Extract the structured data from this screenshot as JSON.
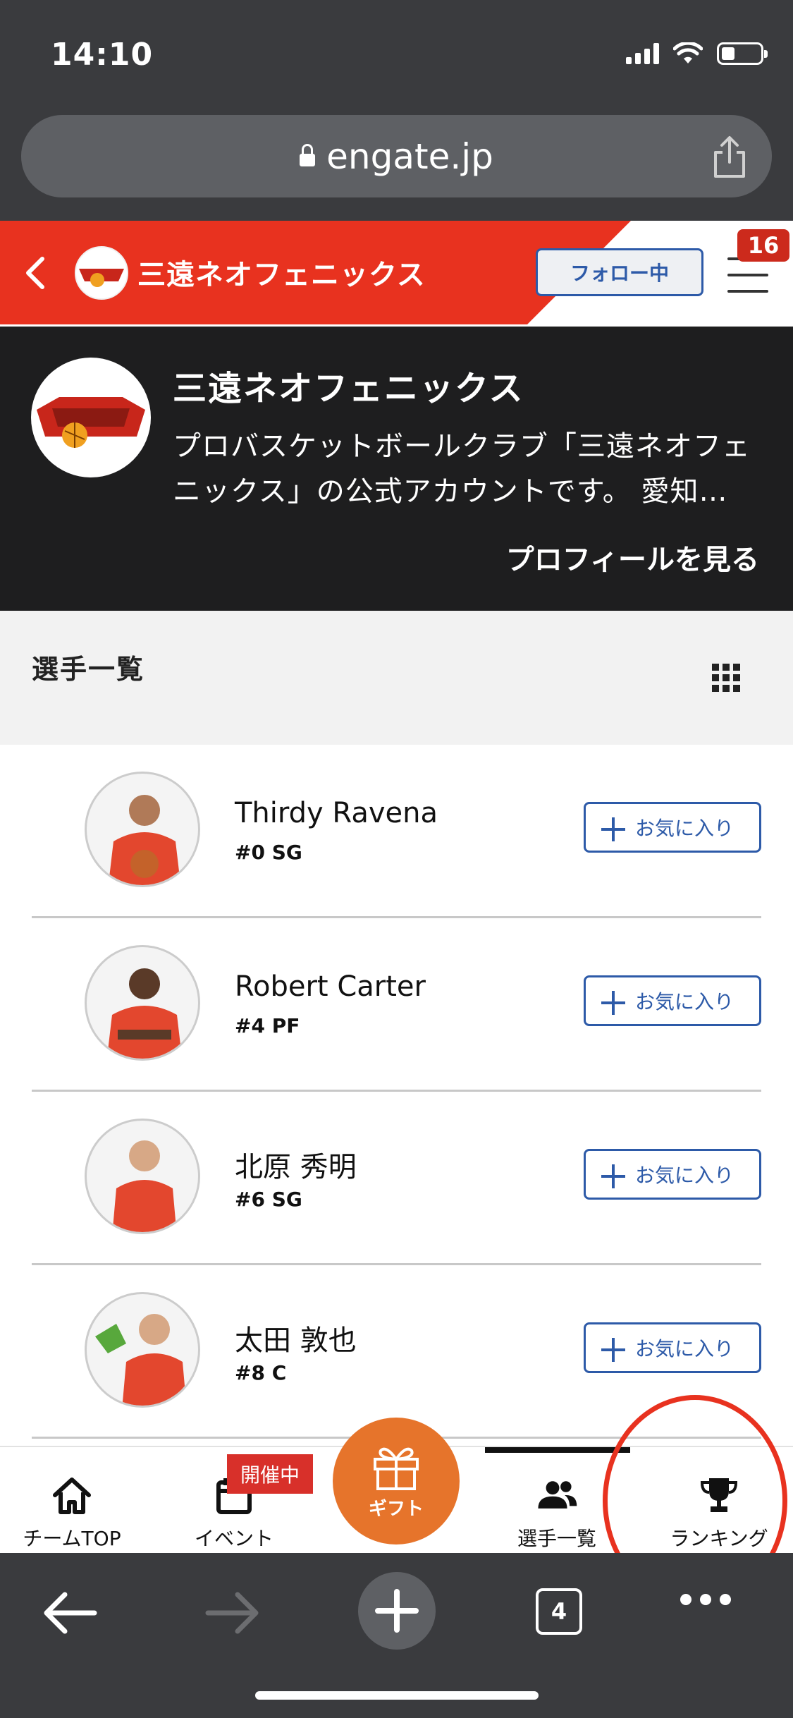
{
  "status_bar": {
    "time": "14:10"
  },
  "browser": {
    "url": "engate.jp",
    "tab_count": "4"
  },
  "team_header": {
    "team_name": "三遠ネオフェニックス",
    "follow_label": "フォロー中",
    "notification_count": "16"
  },
  "profile": {
    "name": "三遠ネオフェニックス",
    "description": "プロバスケットボールクラブ「三遠ネオフェニックス」の公式アカウントです。 愛知…",
    "profile_link": "プロフィールを見る"
  },
  "section": {
    "title": "選手一覧"
  },
  "players": [
    {
      "name": "Thirdy Ravena",
      "position": "#0 SG",
      "button": "お気に入り"
    },
    {
      "name": "Robert Carter",
      "position": "#4 PF",
      "button": "お気に入り"
    },
    {
      "name": "北原 秀明",
      "position": "#6 SG",
      "button": "お気に入り"
    },
    {
      "name": "太田 敦也",
      "position": "#8 C",
      "button": "お気に入り"
    }
  ],
  "tabbar": {
    "team_top": "チームTOP",
    "event": "イベント",
    "event_badge": "開催中",
    "gift": "ギフト",
    "players": "選手一覧",
    "ranking": "ランキング"
  },
  "colors": {
    "brand_red": "#e8321f",
    "link_blue": "#2d5aa8",
    "gift_orange": "#e6742b",
    "profile_bg": "#1e1e1f"
  },
  "icons": [
    "lock-icon",
    "share-icon",
    "back-arrow-icon",
    "hamburger-menu-icon",
    "grid-view-icon",
    "plus-icon",
    "home-icon",
    "calendar-icon",
    "gift-icon",
    "users-icon",
    "trophy-icon",
    "browser-back-icon",
    "browser-forward-icon",
    "new-tab-icon",
    "tabs-icon",
    "more-icon"
  ]
}
